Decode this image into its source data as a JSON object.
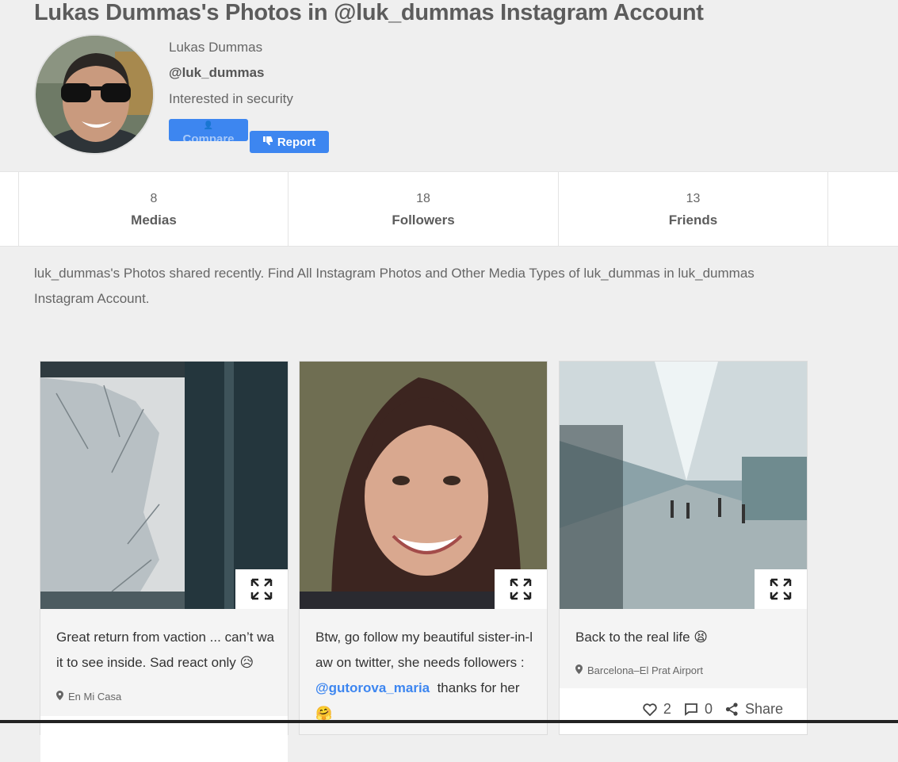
{
  "page": {
    "title": "Lukas Dummas's Photos in @luk_dummas Instagram Account"
  },
  "profile": {
    "full_name": "Lukas Dummas",
    "handle": "@luk_dummas",
    "bio": "Interested in security",
    "compare_label": "Compare",
    "report_label": "Report"
  },
  "stats": [
    {
      "count": "8",
      "label": "Medias"
    },
    {
      "count": "18",
      "label": "Followers"
    },
    {
      "count": "13",
      "label": "Friends"
    }
  ],
  "description": "luk_dummas's Photos shared recently. Find All Instagram Photos and Other Media Types of luk_dummas in luk_dummas Instagram Account.",
  "posts": [
    {
      "caption": "Great return from vaction ... can’t wait to see inside. Sad react only 😥",
      "location": "En Mi Casa"
    },
    {
      "caption_before": "Btw, go follow my beautiful sister-in-law on twitter, she needs followers : ",
      "mention": "@gutorova_maria",
      "caption_after": "  thanks for her 🤗"
    },
    {
      "caption": "Back to the real life 😫",
      "location": "Barcelona–El Prat Airport",
      "likes": "2",
      "comments": "0",
      "share_label": "Share"
    }
  ]
}
